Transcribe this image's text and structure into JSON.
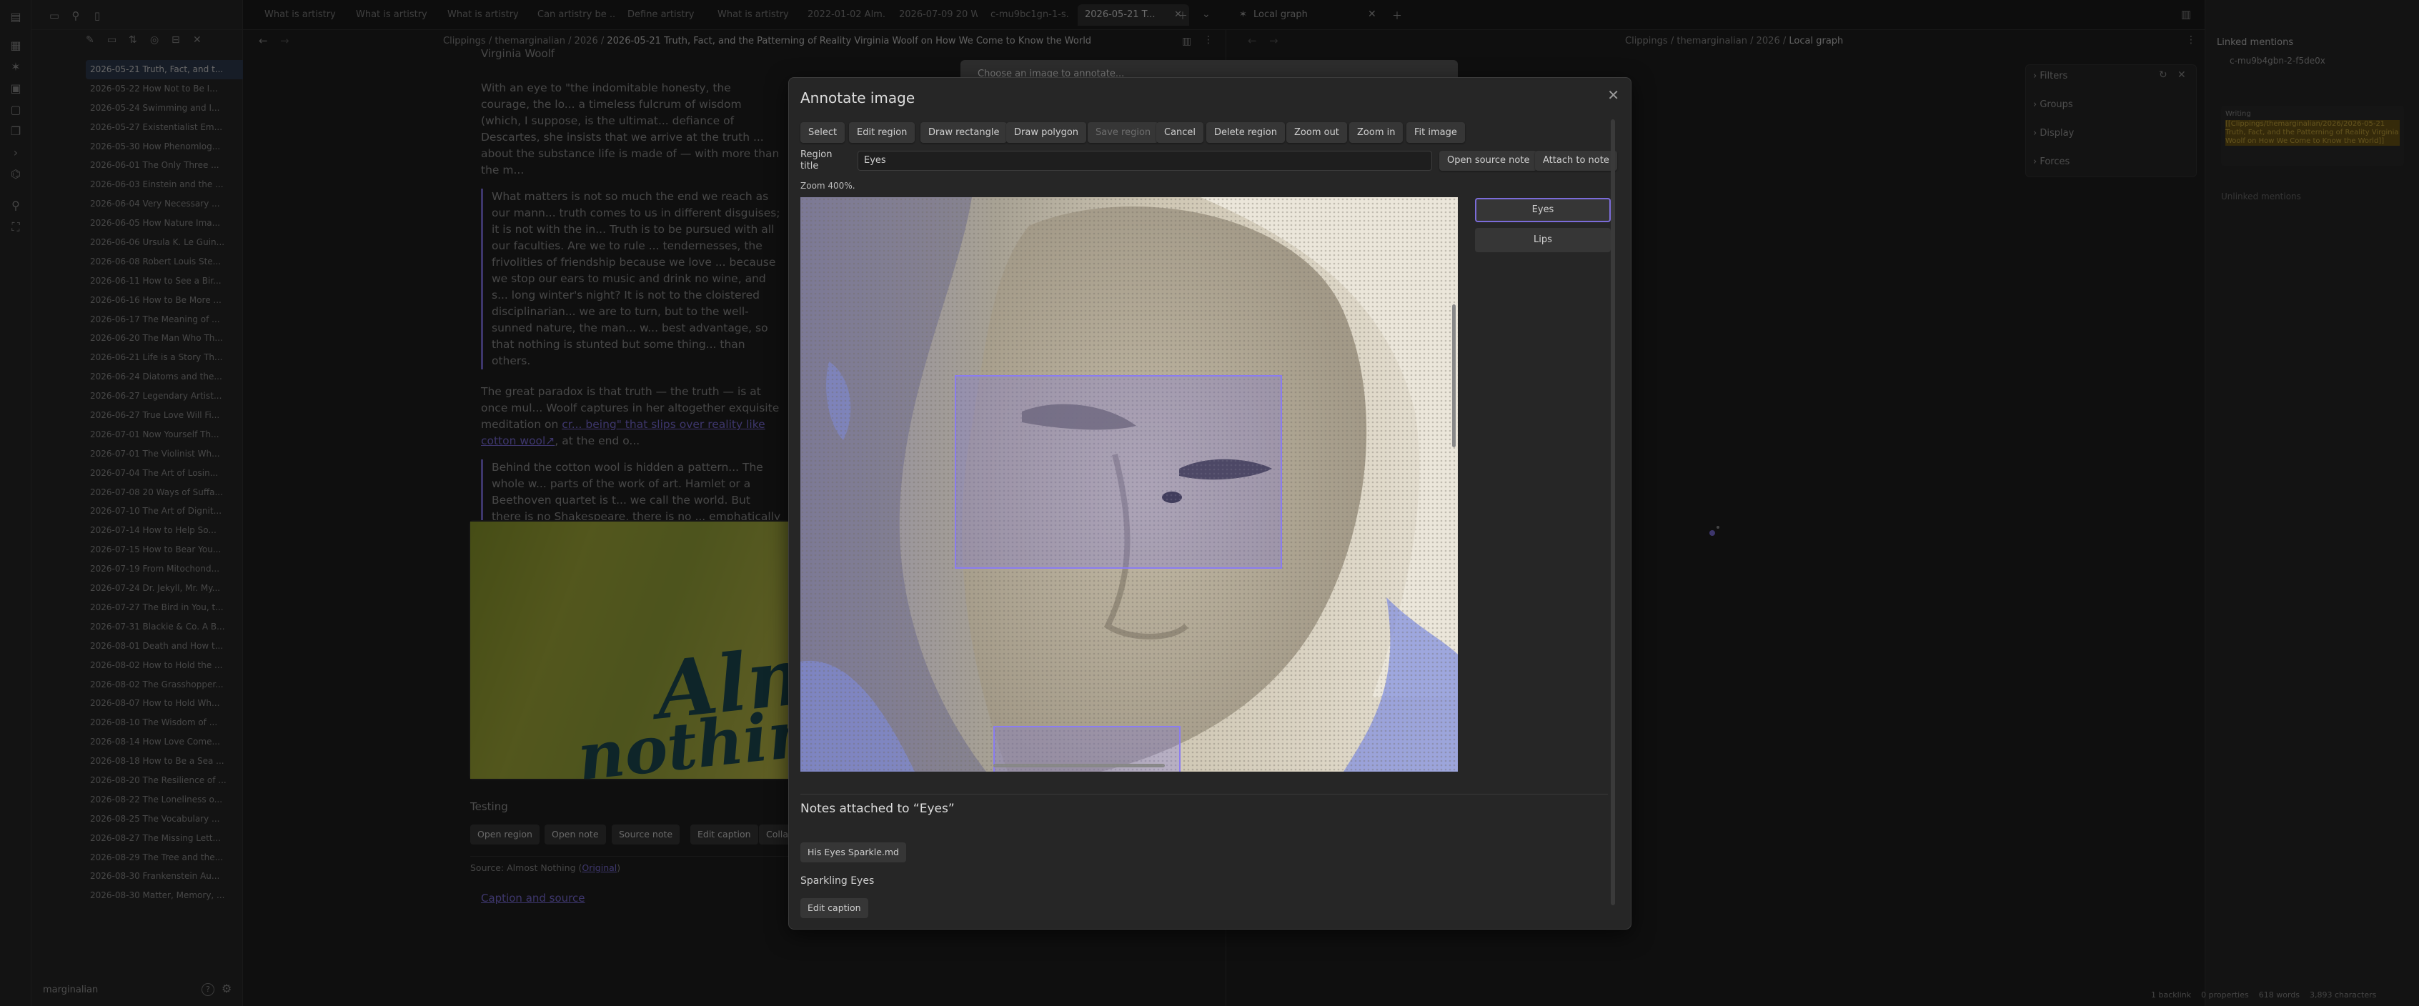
{
  "tabs": [
    "What is artistry",
    "What is artistry",
    "What is artistry",
    "Can artistry be ...",
    "Define artistry",
    "What is artistry",
    "2022-01-02 Alm...",
    "2026-07-09 20 W...",
    "c-mu9bc1gn-1-s...",
    "2026-05-21 T...",
    "Local graph"
  ],
  "breadcrumb": [
    "Clippings",
    "/",
    "themarginalian",
    "/",
    "2026",
    "/",
    "2026-05-21 Truth, Fact, and the Patterning of Reality Virginia Woolf on How We Come to Know the World"
  ],
  "graph_breadcrumb": [
    "Clippings",
    "/",
    "themarginalian",
    "/",
    "2026",
    "/",
    "Local graph"
  ],
  "files": [
    "2026-05-21 Truth, Fact, and t...",
    "2026-05-22 How Not to Be I...",
    "2026-05-24 Swimming and I...",
    "2026-05-27 Existentialist Em...",
    "2026-05-30 How Phenomlog...",
    "2026-06-01 The Only Three ...",
    "2026-06-03 Einstein and the ...",
    "2026-06-04 Very Necessary ...",
    "2026-06-05 How Nature Ima...",
    "2026-06-06 Ursula K. Le Guin...",
    "2026-06-08 Robert Louis Ste...",
    "2026-06-11 How to See a Bir...",
    "2026-06-16 How to Be More ...",
    "2026-06-17 The Meaning of ...",
    "2026-06-20 The Man Who Th...",
    "2026-06-21 Life is a Story Th...",
    "2026-06-24 Diatoms and the...",
    "2026-06-27 Legendary Artist...",
    "2026-06-27 True Love Will Fi...",
    "2026-07-01 Now Yourself Th...",
    "2026-07-01 The Violinist Wh...",
    "2026-07-04 The Art of Losin...",
    "2026-07-08 20 Ways of Suffa...",
    "2026-07-10 The Art of Dignit...",
    "2026-07-14 How to Help So...",
    "2026-07-15 How to Bear You...",
    "2026-07-19 From Mitochond...",
    "2026-07-24 Dr. Jekyll, Mr. My...",
    "2026-07-27 The Bird in You, t...",
    "2026-07-31 Blackie & Co. A B...",
    "2026-08-01 Death and How t...",
    "2026-08-02 How to Hold the ...",
    "2026-08-02 The Grasshopper...",
    "2026-08-07 How to Hold Wh...",
    "2026-08-10 The Wisdom of ...",
    "2026-08-14 How Love Come...",
    "2026-08-18 How to Be a Sea ...",
    "2026-08-20 The Resilience of ...",
    "2026-08-22 The Loneliness o...",
    "2026-08-25 The Vocabulary ...",
    "2026-08-27 The Missing Lett...",
    "2026-08-29 The Tree and the...",
    "2026-08-30 Frankenstein Au...",
    "2026-08-30 Matter, Memory, ..."
  ],
  "vault_name": "marginalian",
  "note": {
    "heading": "Virginia Woolf",
    "p1": "With an eye to \"the indomitable honesty, the courage, the lo... a timeless fulcrum of wisdom (which, I suppose, is the ultimat... defiance of Descartes, she insists that we arrive at the truth ... about the substance life is made of — with more than the m...",
    "q1": "What matters is not so much the end we reach as our mann... truth comes to us in different disguises; it is not with the in... Truth is to be pursued with all our faculties. Are we to rule ... tendernesses, the frivolities of friendship because we love ... because we stop our ears to music and drink no wine, and s... long winter's night? It is not to the cloistered disciplinarian... we are to turn, but to the well-sunned nature, the man... w... best advantage, so that nothing is stunted but some thing... than others.",
    "p2a": "The great paradox is that truth — the truth — is at once mul... Woolf captures in her altogether exquisite meditation on ",
    "p2link": "cr... being\" that slips over reality like cotton wool↗",
    "p2b": ", at the end o...",
    "q2": "Behind the cotton wool is hidden a pattern... The whole w... parts of the work of art. Hamlet or a Beethoven quartet is t... we call the world. But there is no Shakespeare, there is no ... emphatically there is no God; we are the words; we are the...",
    "image_text_1": "Alm",
    "image_text_2": "nothin",
    "caption": "Testing",
    "card_buttons": [
      "Open region",
      "Open note",
      "Source note",
      "Edit caption",
      "Collap..."
    ],
    "source_label": "Source: Almost Nothing (",
    "source_link": "Original",
    "source_end": ")",
    "caption_link": "Caption and source"
  },
  "choose_placeholder": "Choose an image to annotate...",
  "graph_panel": {
    "filters": "Filters",
    "groups": "Groups",
    "display": "Display",
    "forces": "Forces"
  },
  "linked": {
    "title": "Linked mentions",
    "item": "c-mu9b4gbn-2-f5de0x",
    "snippet_label": "Writing",
    "snippet": "[[Clippings/themarginalian/2026/2026-05-21 Truth, Fact, and the Patterning of Reality Virginia Woolf on How We Come to Know the World]]",
    "unlinked": "Unlinked mentions"
  },
  "status": [
    "1 backlink",
    "0 properties",
    "618 words",
    "3,893 characters"
  ],
  "modal": {
    "title": "Annotate image",
    "toolbar": [
      "Select",
      "Edit region",
      "Draw rectangle",
      "Draw polygon",
      "Save region",
      "Cancel",
      "Delete region",
      "Zoom out",
      "Zoom in",
      "Fit image"
    ],
    "region_title_label": "Region title",
    "region_title_value": "Eyes",
    "open_source_note": "Open source note",
    "attach_to_note": "Attach to note",
    "zoom_label": "Zoom 400%.",
    "regions": [
      "Eyes",
      "Lips"
    ],
    "notes_heading": "Notes attached to “Eyes”",
    "note_file": "His Eyes Sparkle.md",
    "caption_text": "Sparkling Eyes",
    "edit_caption": "Edit caption"
  },
  "colors": {
    "accent": "#7b6cd9",
    "highlight": "#8a6d1e",
    "bg": "#1e1e1e"
  }
}
